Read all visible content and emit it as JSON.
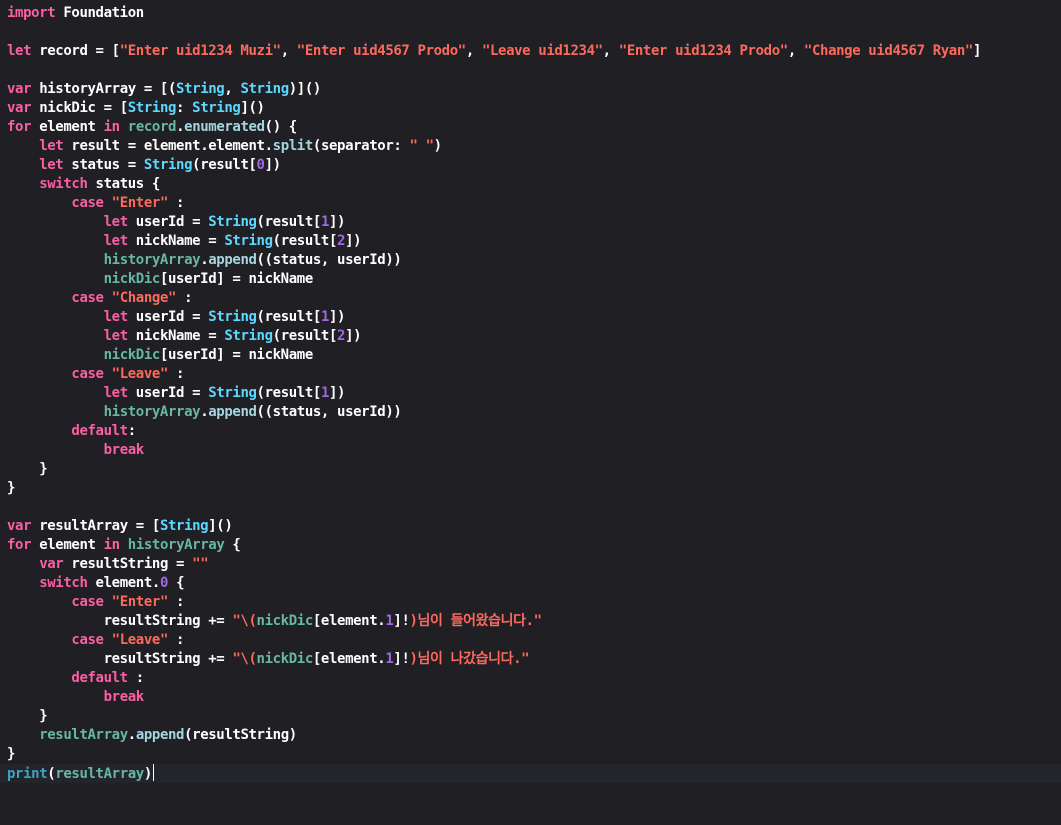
{
  "editor": {
    "language": "Swift",
    "colors": {
      "background": "#1f1f24",
      "current_line": "#23252b",
      "keyword": "#fc5fa3",
      "string": "#fc6a5d",
      "type": "#5dd8ff",
      "plain": "#ffffff",
      "number": "#a167e6",
      "project": "#67b7a4"
    },
    "current_line_index": 40,
    "lines": [
      [
        [
          "keyword",
          "import"
        ],
        [
          "plain",
          " Foundation"
        ]
      ],
      [],
      [
        [
          "keyword",
          "let"
        ],
        [
          "plain",
          " record = ["
        ],
        [
          "string",
          "\"Enter uid1234 Muzi\""
        ],
        [
          "plain",
          ", "
        ],
        [
          "string",
          "\"Enter uid4567 Prodo\""
        ],
        [
          "plain",
          ", "
        ],
        [
          "string",
          "\"Leave uid1234\""
        ],
        [
          "plain",
          ", "
        ],
        [
          "string",
          "\"Enter uid1234 Prodo\""
        ],
        [
          "plain",
          ", "
        ],
        [
          "string",
          "\"Change uid4567 Ryan\""
        ],
        [
          "plain",
          "]"
        ]
      ],
      [],
      [
        [
          "keyword",
          "var"
        ],
        [
          "plain",
          " historyArray = [("
        ],
        [
          "type",
          "String"
        ],
        [
          "plain",
          ", "
        ],
        [
          "type",
          "String"
        ],
        [
          "plain",
          ")]()"
        ]
      ],
      [
        [
          "keyword",
          "var"
        ],
        [
          "plain",
          " nickDic = ["
        ],
        [
          "type",
          "String"
        ],
        [
          "plain",
          ": "
        ],
        [
          "type",
          "String"
        ],
        [
          "plain",
          "]()"
        ]
      ],
      [
        [
          "keyword",
          "for"
        ],
        [
          "plain",
          " element "
        ],
        [
          "keyword",
          "in"
        ],
        [
          "plain",
          " "
        ],
        [
          "project",
          "record"
        ],
        [
          "plain",
          "."
        ],
        [
          "libfn",
          "enumerated"
        ],
        [
          "plain",
          "() {"
        ]
      ],
      [
        [
          "plain",
          "    "
        ],
        [
          "keyword",
          "let"
        ],
        [
          "plain",
          " result = element.element."
        ],
        [
          "libfn",
          "split"
        ],
        [
          "plain",
          "(separator: "
        ],
        [
          "string",
          "\" \""
        ],
        [
          "plain",
          ")"
        ]
      ],
      [
        [
          "plain",
          "    "
        ],
        [
          "keyword",
          "let"
        ],
        [
          "plain",
          " status = "
        ],
        [
          "type",
          "String"
        ],
        [
          "plain",
          "(result["
        ],
        [
          "number",
          "0"
        ],
        [
          "plain",
          "])"
        ]
      ],
      [
        [
          "plain",
          "    "
        ],
        [
          "keyword",
          "switch"
        ],
        [
          "plain",
          " status {"
        ]
      ],
      [
        [
          "plain",
          "        "
        ],
        [
          "keyword",
          "case"
        ],
        [
          "plain",
          " "
        ],
        [
          "string",
          "\"Enter\""
        ],
        [
          "plain",
          " :"
        ]
      ],
      [
        [
          "plain",
          "            "
        ],
        [
          "keyword",
          "let"
        ],
        [
          "plain",
          " userId = "
        ],
        [
          "type",
          "String"
        ],
        [
          "plain",
          "(result["
        ],
        [
          "number",
          "1"
        ],
        [
          "plain",
          "])"
        ]
      ],
      [
        [
          "plain",
          "            "
        ],
        [
          "keyword",
          "let"
        ],
        [
          "plain",
          " nickName = "
        ],
        [
          "type",
          "String"
        ],
        [
          "plain",
          "(result["
        ],
        [
          "number",
          "2"
        ],
        [
          "plain",
          "])"
        ]
      ],
      [
        [
          "plain",
          "            "
        ],
        [
          "project",
          "historyArray"
        ],
        [
          "plain",
          "."
        ],
        [
          "libfn",
          "append"
        ],
        [
          "plain",
          "((status, userId))"
        ]
      ],
      [
        [
          "plain",
          "            "
        ],
        [
          "project",
          "nickDic"
        ],
        [
          "plain",
          "[userId] = nickName"
        ]
      ],
      [
        [
          "plain",
          "        "
        ],
        [
          "keyword",
          "case"
        ],
        [
          "plain",
          " "
        ],
        [
          "string",
          "\"Change\""
        ],
        [
          "plain",
          " :"
        ]
      ],
      [
        [
          "plain",
          "            "
        ],
        [
          "keyword",
          "let"
        ],
        [
          "plain",
          " userId = "
        ],
        [
          "type",
          "String"
        ],
        [
          "plain",
          "(result["
        ],
        [
          "number",
          "1"
        ],
        [
          "plain",
          "])"
        ]
      ],
      [
        [
          "plain",
          "            "
        ],
        [
          "keyword",
          "let"
        ],
        [
          "plain",
          " nickName = "
        ],
        [
          "type",
          "String"
        ],
        [
          "plain",
          "(result["
        ],
        [
          "number",
          "2"
        ],
        [
          "plain",
          "])"
        ]
      ],
      [
        [
          "plain",
          "            "
        ],
        [
          "project",
          "nickDic"
        ],
        [
          "plain",
          "[userId] = nickName"
        ]
      ],
      [
        [
          "plain",
          "        "
        ],
        [
          "keyword",
          "case"
        ],
        [
          "plain",
          " "
        ],
        [
          "string",
          "\"Leave\""
        ],
        [
          "plain",
          " :"
        ]
      ],
      [
        [
          "plain",
          "            "
        ],
        [
          "keyword",
          "let"
        ],
        [
          "plain",
          " userId = "
        ],
        [
          "type",
          "String"
        ],
        [
          "plain",
          "(result["
        ],
        [
          "number",
          "1"
        ],
        [
          "plain",
          "])"
        ]
      ],
      [
        [
          "plain",
          "            "
        ],
        [
          "project",
          "historyArray"
        ],
        [
          "plain",
          "."
        ],
        [
          "libfn",
          "append"
        ],
        [
          "plain",
          "((status, userId))"
        ]
      ],
      [
        [
          "plain",
          "        "
        ],
        [
          "keyword",
          "default"
        ],
        [
          "plain",
          ":"
        ]
      ],
      [
        [
          "plain",
          "            "
        ],
        [
          "keyword",
          "break"
        ]
      ],
      [
        [
          "plain",
          "    }"
        ]
      ],
      [
        [
          "plain",
          "}"
        ]
      ],
      [],
      [
        [
          "keyword",
          "var"
        ],
        [
          "plain",
          " resultArray = ["
        ],
        [
          "type",
          "String"
        ],
        [
          "plain",
          "]()"
        ]
      ],
      [
        [
          "keyword",
          "for"
        ],
        [
          "plain",
          " element "
        ],
        [
          "keyword",
          "in"
        ],
        [
          "plain",
          " "
        ],
        [
          "project",
          "historyArray"
        ],
        [
          "plain",
          " {"
        ]
      ],
      [
        [
          "plain",
          "    "
        ],
        [
          "keyword",
          "var"
        ],
        [
          "plain",
          " resultString = "
        ],
        [
          "string",
          "\"\""
        ]
      ],
      [
        [
          "plain",
          "    "
        ],
        [
          "keyword",
          "switch"
        ],
        [
          "plain",
          " element."
        ],
        [
          "number",
          "0"
        ],
        [
          "plain",
          " {"
        ]
      ],
      [
        [
          "plain",
          "        "
        ],
        [
          "keyword",
          "case"
        ],
        [
          "plain",
          " "
        ],
        [
          "string",
          "\"Enter\""
        ],
        [
          "plain",
          " :"
        ]
      ],
      [
        [
          "plain",
          "            resultString += "
        ],
        [
          "string",
          "\"\\("
        ],
        [
          "project",
          "nickDic"
        ],
        [
          "plain",
          "[element."
        ],
        [
          "number",
          "1"
        ],
        [
          "plain",
          "]!"
        ],
        [
          "string",
          ")님이 들어왔습니다.\""
        ]
      ],
      [
        [
          "plain",
          "        "
        ],
        [
          "keyword",
          "case"
        ],
        [
          "plain",
          " "
        ],
        [
          "string",
          "\"Leave\""
        ],
        [
          "plain",
          " :"
        ]
      ],
      [
        [
          "plain",
          "            resultString += "
        ],
        [
          "string",
          "\"\\("
        ],
        [
          "project",
          "nickDic"
        ],
        [
          "plain",
          "[element."
        ],
        [
          "number",
          "1"
        ],
        [
          "plain",
          "]!"
        ],
        [
          "string",
          ")님이 나갔습니다.\""
        ]
      ],
      [
        [
          "plain",
          "        "
        ],
        [
          "keyword",
          "default"
        ],
        [
          "plain",
          " :"
        ]
      ],
      [
        [
          "plain",
          "            "
        ],
        [
          "keyword",
          "break"
        ]
      ],
      [
        [
          "plain",
          "    }"
        ]
      ],
      [
        [
          "plain",
          "    "
        ],
        [
          "project",
          "resultArray"
        ],
        [
          "plain",
          "."
        ],
        [
          "libfn",
          "append"
        ],
        [
          "plain",
          "(resultString)"
        ]
      ],
      [
        [
          "plain",
          "}"
        ]
      ],
      [
        [
          "projfn",
          "print"
        ],
        [
          "plain",
          "("
        ],
        [
          "project",
          "resultArray"
        ],
        [
          "plain",
          ")"
        ]
      ]
    ]
  }
}
